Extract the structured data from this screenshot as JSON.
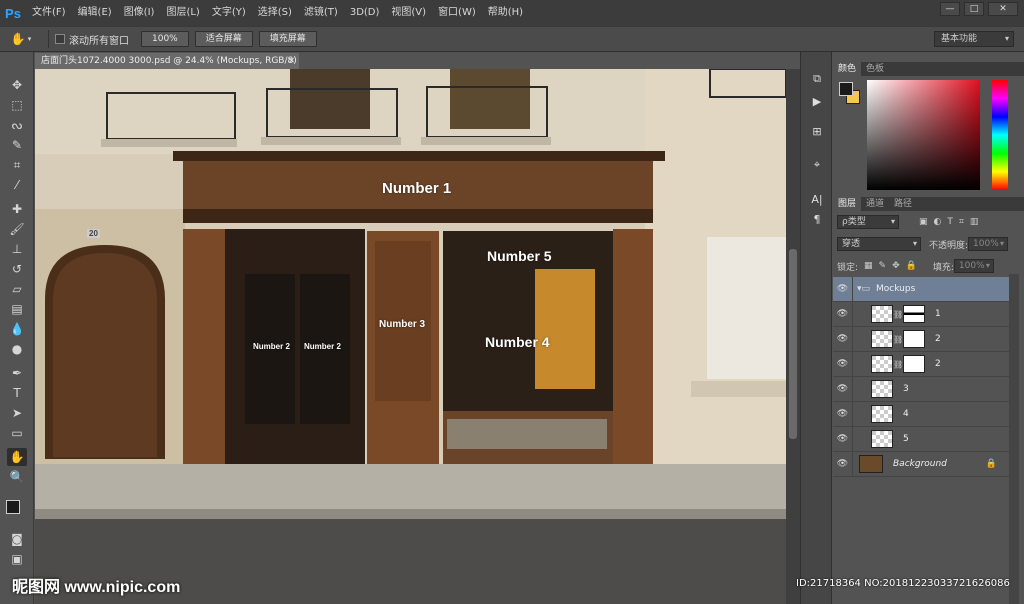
{
  "app": {
    "logo": "Ps"
  },
  "menu": [
    "文件(F)",
    "编辑(E)",
    "图像(I)",
    "图层(L)",
    "文字(Y)",
    "选择(S)",
    "滤镜(T)",
    "3D(D)",
    "视图(V)",
    "窗口(W)",
    "帮助(H)"
  ],
  "window_buttons": {
    "minimize": "—",
    "restore": "□",
    "close": "✕"
  },
  "options": {
    "scroll_all_windows": "滚动所有窗口",
    "btn_100": "100%",
    "btn_fit": "适合屏幕",
    "btn_fill": "填充屏幕",
    "workspace": "基本功能"
  },
  "document": {
    "tab_title": "店面门头1072.4000 3000.psd @ 24.4% (Mockups, RGB/8) *",
    "close": "✕"
  },
  "canvas_labels": {
    "n1": "Number 1",
    "n2a": "Number 2",
    "n2b": "Number 2",
    "n3": "Number 3",
    "n4": "Number 4",
    "n5": "Number 5",
    "door_number": "20"
  },
  "panels": {
    "color_tabs": [
      "颜色",
      "色板"
    ],
    "layer_tabs": [
      "图层",
      "通道",
      "路径"
    ],
    "filter_kind": "ρ类型",
    "blend_mode": "穿透",
    "opacity_label": "不透明度:",
    "opacity_value": "100%",
    "lock_label": "锁定:",
    "fill_label": "填充:",
    "fill_value": "100%"
  },
  "layers": [
    {
      "name": "Mockups",
      "type": "group",
      "selected": true
    },
    {
      "name": "1",
      "type": "smart-mask-black"
    },
    {
      "name": "2",
      "type": "smart-mask"
    },
    {
      "name": "2",
      "type": "smart-mask"
    },
    {
      "name": "3",
      "type": "smart"
    },
    {
      "name": "4",
      "type": "smart"
    },
    {
      "name": "5",
      "type": "smart"
    },
    {
      "name": "Background",
      "type": "background"
    }
  ],
  "watermark": {
    "left": "昵图网 www.nipic.com",
    "right": "ID:21718364 NO:20181223033721626086"
  },
  "colors": {
    "foreground": "#1a1a1a",
    "background": "#f2c94c",
    "selection": "#6f7f96"
  }
}
